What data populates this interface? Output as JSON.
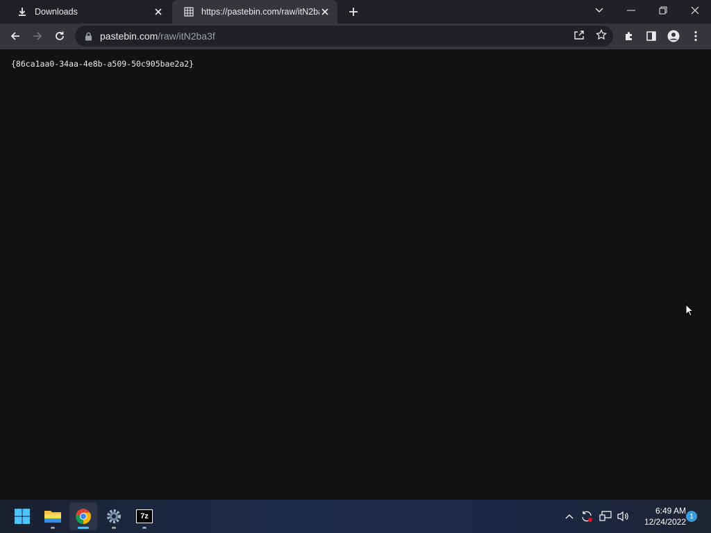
{
  "browser": {
    "tabs": [
      {
        "title": "Downloads",
        "icon": "download-icon",
        "active": false
      },
      {
        "title": "https://pastebin.com/raw/itN2ba",
        "icon": "pastebin-icon",
        "active": true
      }
    ],
    "address": {
      "host": "pastebin.com",
      "path": "/raw/itN2ba3f"
    }
  },
  "page": {
    "raw_text": "{86ca1aa0-34aa-4e8b-a509-50c905bae2a2}"
  },
  "taskbar": {
    "apps": [
      "windows-start-icon",
      "file-explorer-icon",
      "chrome-icon",
      "settings-icon",
      "7zip-icon"
    ],
    "app_7zip_label": "7z",
    "clock": {
      "time": "6:49 AM",
      "date": "12/24/2022"
    },
    "notification_count": "1"
  },
  "colors": {
    "accent": "#8ab4f8",
    "page_bg": "#121212",
    "tab_active": "#35363a"
  }
}
